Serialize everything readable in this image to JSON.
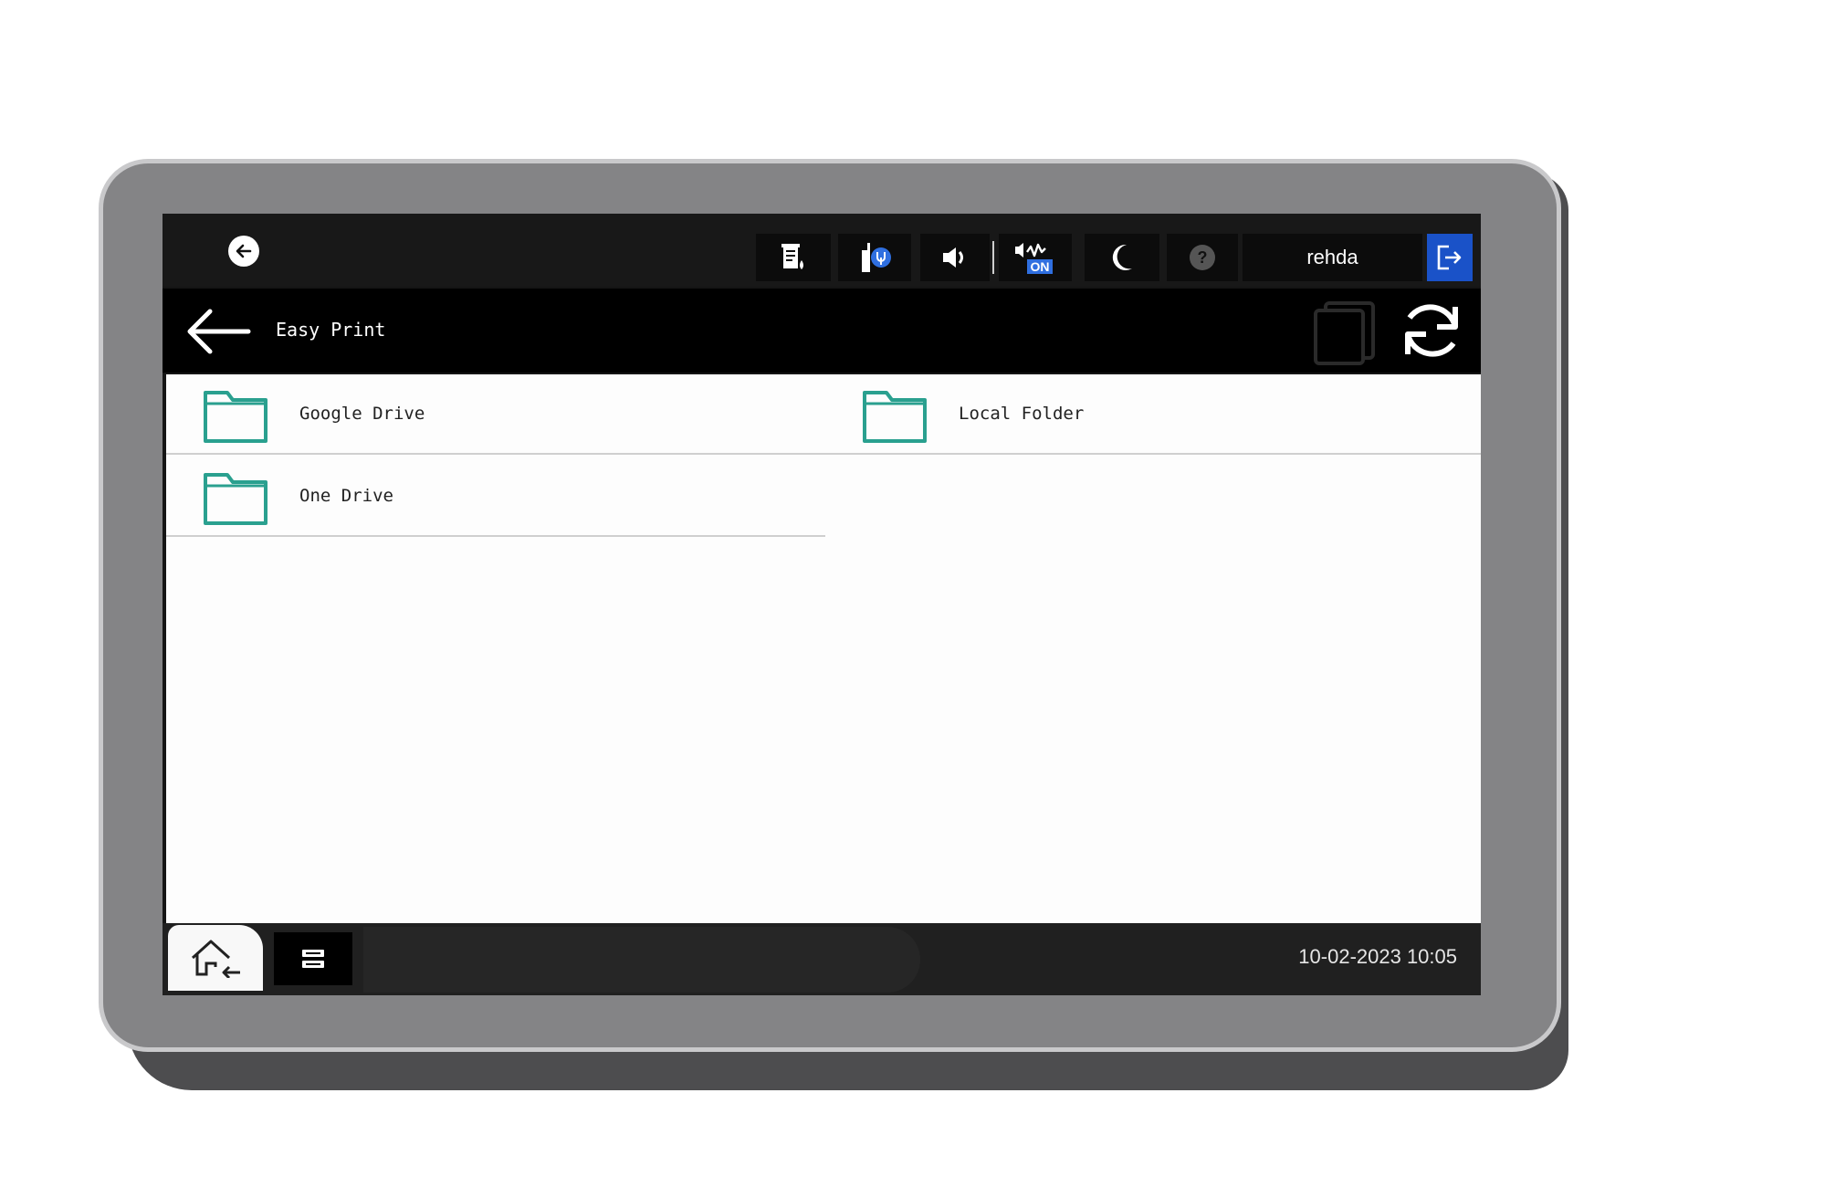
{
  "topbar": {
    "back_icon": "back-arrow-icon",
    "status_icons": [
      "toner-status-icon",
      "wifi-direct-usb-icon",
      "volume-icon",
      "energy-saver-on-icon",
      "sleep-moon-icon",
      "help-icon"
    ],
    "energy_badge": "ON",
    "user_name": "rehda",
    "logout_icon": "logout-icon"
  },
  "header": {
    "title": "Easy Print",
    "actions": [
      "copy-icon",
      "refresh-icon"
    ]
  },
  "sources": [
    {
      "label": "Google Drive",
      "icon": "folder-icon"
    },
    {
      "label": "Local Folder",
      "icon": "folder-icon"
    },
    {
      "label": "One Drive",
      "icon": "folder-icon"
    }
  ],
  "footer": {
    "home_icon": "home-icon",
    "jobs_icon": "job-list-icon",
    "datetime": "10-02-2023 10:05"
  },
  "colors": {
    "accent_folder": "#2aa08f",
    "logout_bg": "#1a52c8",
    "header_bg": "#000000",
    "bezel": "#848486"
  }
}
